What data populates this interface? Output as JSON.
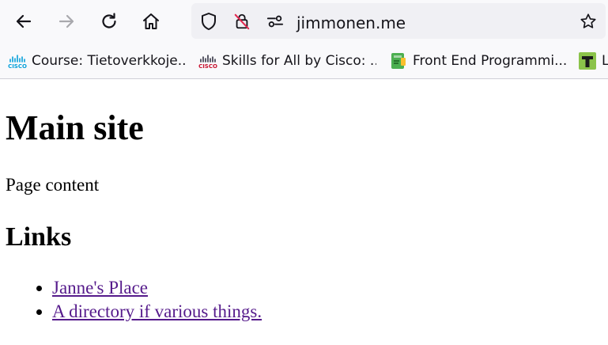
{
  "browser": {
    "url": "jimmonen.me",
    "icons": {
      "back": "back-arrow-icon",
      "forward": "forward-arrow-icon",
      "reload": "reload-icon",
      "home": "home-icon",
      "shield": "shield-icon",
      "lock": "insecure-lock-icon",
      "permissions": "permissions-icon",
      "bookmark_star": "star-icon"
    },
    "colors": {
      "toolbar_bg": "#f9f9fb",
      "urlbar_bg": "#f0f0f4",
      "insecure_slash": "#e22850",
      "icon": "#15141a",
      "disabled_icon": "#a9a9ad"
    }
  },
  "bookmarks": [
    {
      "label": "Course: Tietoverkkoje...",
      "icon": "cisco-favicon"
    },
    {
      "label": "Skills for All by Cisco: ...",
      "icon": "cisco-favicon"
    },
    {
      "label": "Front End Programmi...",
      "icon": "notebook-favicon"
    },
    {
      "label": "L",
      "icon": "t-favicon"
    }
  ],
  "page": {
    "title": "Main site",
    "content": "Page content",
    "links_heading": "Links",
    "links": [
      {
        "label": "Janne's Place"
      },
      {
        "label": "A directory if various things."
      }
    ],
    "colors": {
      "visited_link": "#551a8b"
    }
  }
}
